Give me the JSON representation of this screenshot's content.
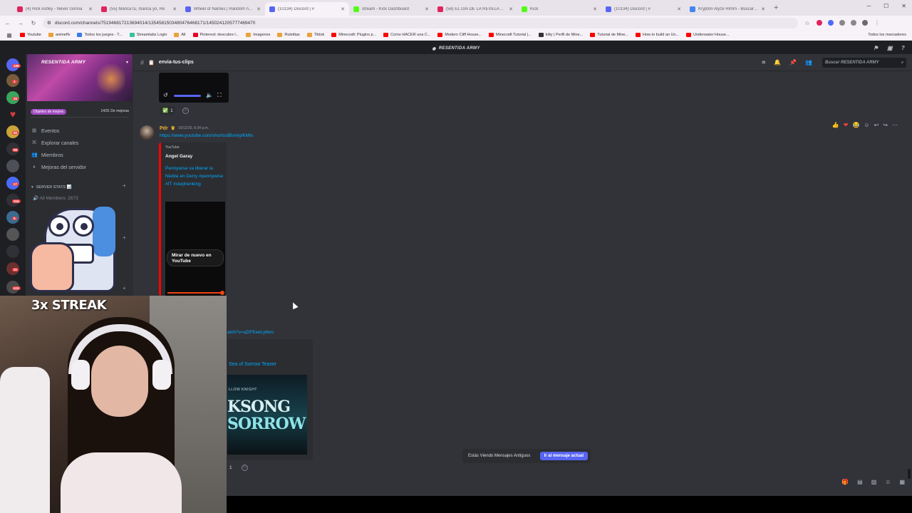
{
  "browser": {
    "tabs": [
      {
        "title": "(4) Rick Astley - Never Gonna",
        "color": "#e0245e"
      },
      {
        "title": "(55) Marica tu, marica yo, Re",
        "color": "#e0245e"
      },
      {
        "title": "Wheel of Names | Random nam",
        "color": "#5865f2"
      },
      {
        "title": "(10134) Discord | #",
        "color": "#5865f2"
      },
      {
        "title": "stream - Kick Dashboard",
        "color": "#53fc18"
      },
      {
        "title": "(56) EL DÍA DE LA REVELACIÓ",
        "color": "#e0245e"
      },
      {
        "title": "Kick",
        "color": "#53fc18"
      },
      {
        "title": "(10134) Discord | #",
        "color": "#5865f2"
      },
      {
        "title": "Krypton Alyze Rimm - Buscar co",
        "color": "#4285f4"
      }
    ],
    "url": "discord.com/channels/751946817213694014/1354581503480476468171/1450241205777469470",
    "bookmarks": [
      {
        "label": "Youtube",
        "color": "#ff0000"
      },
      {
        "label": "animeflv",
        "color": "#e9a23b"
      },
      {
        "label": "Todos los juegos - T...",
        "color": "#3b7be9"
      },
      {
        "label": "Streamlabs Login",
        "color": "#31c3a2"
      },
      {
        "label": "All",
        "color": "#e9a23b"
      },
      {
        "label": "Pinterest: descubre l...",
        "color": "#e60023"
      },
      {
        "label": "Imagenes",
        "color": "#e9a23b"
      },
      {
        "label": "Ruletitas",
        "color": "#e9a23b"
      },
      {
        "label": "Tiktok",
        "color": "#e9a23b"
      },
      {
        "label": "Minecraft: Plugins p...",
        "color": "#ff0000"
      },
      {
        "label": "Como HACER una C...",
        "color": "#ff0000"
      },
      {
        "label": "Modern Cliff House...",
        "color": "#ff0000"
      },
      {
        "label": "Minecraft Tutorial |...",
        "color": "#ff0000"
      },
      {
        "label": "kitty | Perfil de Mine...",
        "color": "#333333"
      },
      {
        "label": "Tutorial de Mine...",
        "color": "#ff0000"
      },
      {
        "label": "How to build an Un...",
        "color": "#ff0000"
      },
      {
        "label": "Underwater House...",
        "color": "#ff0000"
      }
    ],
    "bookmarks_right": "Todos los marcadores"
  },
  "discord": {
    "app_title": "RESENTIDA ARMY",
    "server_name": "RESENTIDA ARMY",
    "boost_goal": "Objetivo de mejora",
    "boost_count": "14/31 De mejoras",
    "sidebar_items": [
      {
        "label": "Eventos",
        "icon": "calendar-icon"
      },
      {
        "label": "Explorar canales",
        "icon": "explore-icon"
      },
      {
        "label": "Miembros",
        "icon": "members-icon"
      },
      {
        "label": "Mejoras del servidor",
        "icon": "boost-icon"
      }
    ],
    "category": "SERVER STATS 📊",
    "stat_channel": "All Members: 2673",
    "channel_name": "envia-tus-clips",
    "search_placeholder": "Buscar RESENTIDA ARMY",
    "rail_badges": [
      "198",
      "1",
      "29",
      "95",
      "96",
      "27",
      "316",
      "5",
      "31",
      "424"
    ],
    "message1": {
      "reaction_count": "1",
      "reaction_emoji": "✅"
    },
    "message2": {
      "author": "Pdr",
      "timestamp": "10/12/25, 6:34 p.m.",
      "link": "https://www.youtube.com/shorts/dBvnkylKMlo",
      "embed_provider": "YouTube",
      "embed_author": "Angel Garay",
      "embed_title": "Pennywise va liberar la Niebla en Derry #pennywise #IT #stephenking",
      "rewatch_label": "Mirar de nuevo en YouTube"
    },
    "message3": {
      "link_fragment": "atch?v=qDFEeeLy6ws",
      "embed_title": "Sea of Sorrow Teaser",
      "thumb_subtitle": "LLOW KNIGHT",
      "thumb_line1": "KSONG",
      "thumb_line2": "SORROW",
      "reaction_count": "1"
    },
    "old_messages_text": "Estás Viendo Mensajes Antiguos",
    "jump_button": "Ir al mensaje actual"
  },
  "overlay": {
    "streak_text": "3x STREAK"
  }
}
